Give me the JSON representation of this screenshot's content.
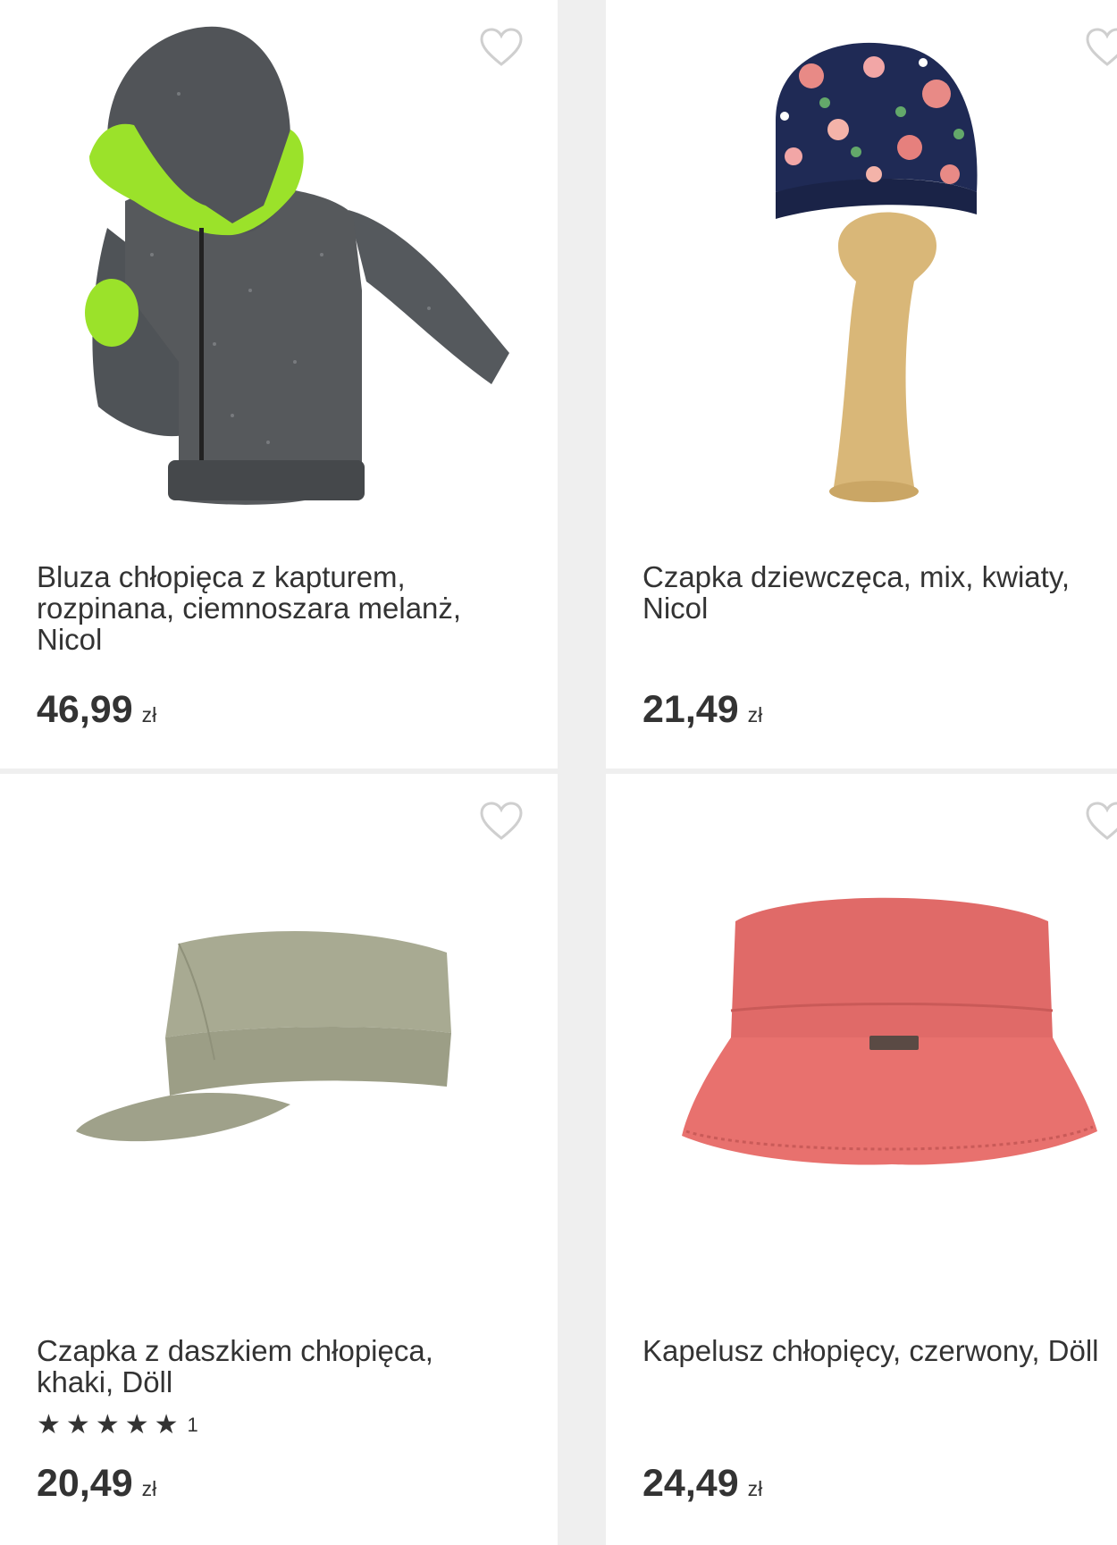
{
  "products": [
    {
      "title": "Bluza chłopięca z kapturem, rozpinana, ciemnoszara melanż, Nicol",
      "price": "46,99",
      "currency": "zł",
      "image": "hoodie",
      "favorite_icon": "heart-outline-icon"
    },
    {
      "title": "Czapka dziewczęca, mix, kwiaty, Nicol",
      "price": "21,49",
      "currency": "zł",
      "image": "floral-turban-hat",
      "favorite_icon": "heart-outline-icon"
    },
    {
      "title": "Czapka z daszkiem chłopięca, khaki, Döll",
      "price": "20,49",
      "currency": "zł",
      "rating_stars": 5,
      "rating_count": "1",
      "image": "khaki-cap",
      "favorite_icon": "heart-outline-icon"
    },
    {
      "title": "Kapelusz chłopięcy, czerwony, Döll",
      "price": "24,49",
      "currency": "zł",
      "image": "red-bucket-hat",
      "favorite_icon": "heart-outline-icon"
    }
  ],
  "colors": {
    "background": "#efefef",
    "card": "#ffffff",
    "text": "#333333",
    "heart_outline": "#cfcfcf"
  }
}
